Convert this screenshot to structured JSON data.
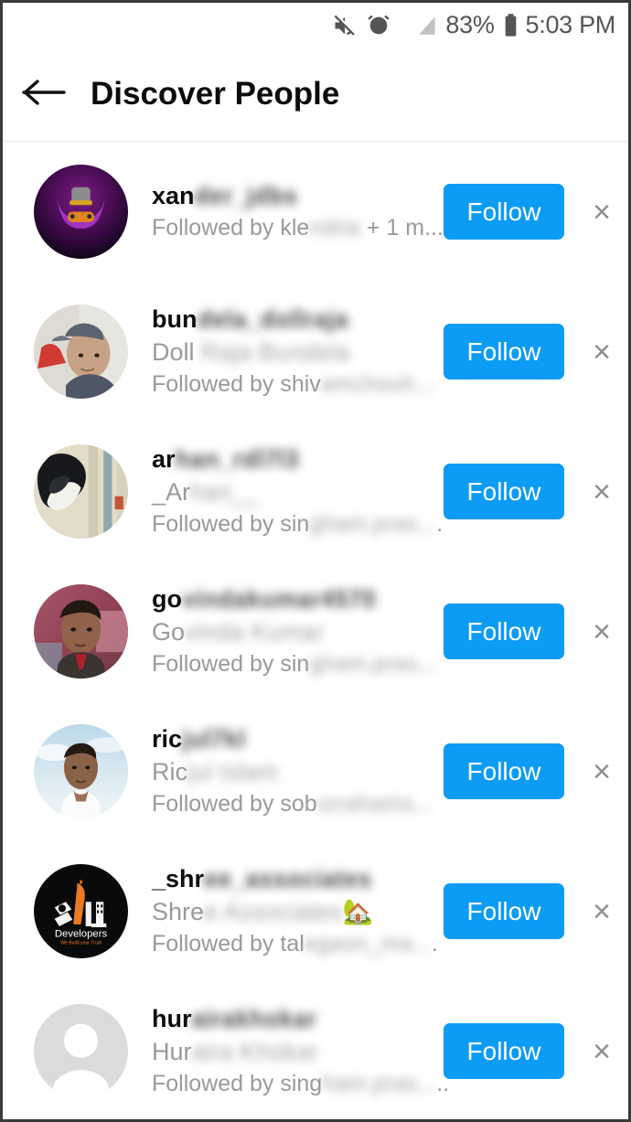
{
  "status_bar": {
    "mute_icon": "mute-icon",
    "alarm_icon": "alarm-clock-icon",
    "signal_icon": "signal-icon",
    "battery_percent": "83%",
    "battery_icon": "battery-icon",
    "time": "5:03 PM"
  },
  "header": {
    "back_icon": "back-arrow-icon",
    "title": "Discover People"
  },
  "list": {
    "follow_label": "Follow",
    "close_label": "×",
    "items": [
      {
        "username_clear": "xan",
        "username_blur": "der_jdbs",
        "fullname_clear": "",
        "fullname_blur": "",
        "followed_clear": "Followed by kle",
        "followed_blur": "ndria",
        "followed_tail": " + 1 m...",
        "avatar": "gamer-logo-avatar"
      },
      {
        "username_clear": "bun",
        "username_blur": "dela_dollraja",
        "fullname_clear": "Doll",
        "fullname_blur": " Raja Bundela",
        "followed_clear": "Followed by shiv",
        "followed_blur": "amchouh...",
        "followed_tail": "",
        "avatar": "cap-man-photo-avatar"
      },
      {
        "username_clear": "ar",
        "username_blur": "han_rdl7l3",
        "fullname_clear": "_Ar",
        "fullname_blur": "han__",
        "followed_clear": "Followed by sin",
        "followed_blur": "gham.pras...",
        "followed_tail": ".",
        "avatar": "masked-person-photo-avatar"
      },
      {
        "username_clear": "go",
        "username_blur": "vindakumar4570",
        "fullname_clear": "Go",
        "fullname_blur": "vinda Kumar",
        "followed_clear": "Followed by sin",
        "followed_blur": "gham.pras...",
        "followed_tail": "",
        "avatar": "young-man-photo-avatar"
      },
      {
        "username_clear": "ric",
        "username_blur": "jul7kl",
        "fullname_clear": "Ric",
        "fullname_blur": "jul Islam",
        "followed_clear": "Followed by sob",
        "followed_blur": "urrahams...",
        "followed_tail": "",
        "avatar": "sky-portrait-photo-avatar"
      },
      {
        "username_clear": "_shr",
        "username_blur": "ee_associates",
        "fullname_clear": "Shre",
        "fullname_blur": "e Associates",
        "fullname_emoji": "🏡",
        "followed_clear": "Followed by tal",
        "followed_blur": "egaon_ma...",
        "followed_tail": ".",
        "avatar": "developers-logo-avatar"
      },
      {
        "username_clear": "hur",
        "username_blur": "airakhokar",
        "fullname_clear": "Hur",
        "fullname_blur": "aira Khokar",
        "followed_clear": "Followed by sing",
        "followed_blur": "ham.pras...",
        "followed_tail": "..",
        "avatar": "default-person-avatar"
      }
    ]
  },
  "colors": {
    "follow_blue": "#0c9bf5",
    "muted_text": "#9a9a9a",
    "primary_text": "#0d0d0d"
  }
}
